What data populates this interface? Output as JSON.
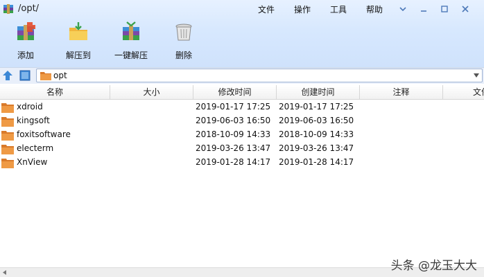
{
  "window": {
    "title": "/opt/"
  },
  "menu": {
    "file": "文件",
    "operate": "操作",
    "tools": "工具",
    "help": "帮助"
  },
  "toolbar": {
    "add": "添加",
    "extract_to": "解压到",
    "one_click_extract": "一键解压",
    "delete": "删除"
  },
  "address": {
    "path": "opt"
  },
  "columns": {
    "name": "名称",
    "size": "大小",
    "modified": "修改时间",
    "created": "创建时间",
    "comment": "注释",
    "overflow": "文件"
  },
  "files": [
    {
      "name": "xdroid",
      "modified": "2019-01-17 17:25",
      "created": "2019-01-17 17:25"
    },
    {
      "name": "kingsoft",
      "modified": "2019-06-03 16:50",
      "created": "2019-06-03 16:50"
    },
    {
      "name": "foxitsoftware",
      "modified": "2018-10-09 14:33",
      "created": "2018-10-09 14:33"
    },
    {
      "name": "electerm",
      "modified": "2019-03-26 13:47",
      "created": "2019-03-26 13:47"
    },
    {
      "name": "XnView",
      "modified": "2019-01-28 14:17",
      "created": "2019-01-28 14:17"
    }
  ],
  "watermark": "头条 @龙玉大大",
  "colors": {
    "chrome_top": "#e7f1ff",
    "chrome_bottom": "#cfe2fc",
    "folder": "#e9923a",
    "nav_blue": "#3b87d6"
  }
}
